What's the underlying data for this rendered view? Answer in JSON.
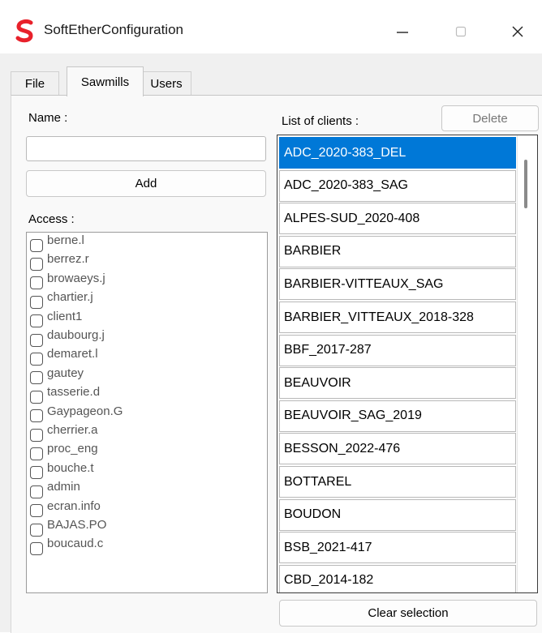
{
  "window": {
    "title": "SoftEtherConfiguration"
  },
  "tabs": [
    {
      "label": "File"
    },
    {
      "label": "Sawmills"
    },
    {
      "label": "Users"
    }
  ],
  "sawmills": {
    "name_label": "Name :",
    "name_value": "",
    "add_label": "Add",
    "access_label": "Access :",
    "access_items": [
      "berne.l",
      "berrez.r",
      "browaeys.j",
      "chartier.j",
      "client1",
      "daubourg.j",
      "demaret.l",
      "gautey",
      "tasserie.d",
      "Gaypageon.G",
      "cherrier.a",
      "proc_eng",
      "bouche.t",
      "admin",
      "ecran.info",
      "BAJAS.PO",
      "boucaud.c"
    ],
    "clients_label": "List of clients :",
    "delete_label": "Delete",
    "clients": [
      "ADC_2020-383_DEL",
      "ADC_2020-383_SAG",
      "ALPES-SUD_2020-408",
      "BARBIER",
      "BARBIER-VITTEAUX_SAG",
      "BARBIER_VITTEAUX_2018-328",
      "BBF_2017-287",
      "BEAUVOIR",
      "BEAUVOIR_SAG_2019",
      "BESSON_2022-476",
      "BOTTAREL",
      "BOUDON",
      "BSB_2021-417",
      "CBD_2014-182"
    ],
    "selected_client_index": 0,
    "clear_label": "Clear selection"
  },
  "colors": {
    "accent": "#0078d7",
    "logo": "#e8212b"
  },
  "icons": {
    "app": "softether-logo-icon",
    "minimize": "minimize-icon",
    "maximize": "maximize-icon",
    "close": "close-icon"
  }
}
